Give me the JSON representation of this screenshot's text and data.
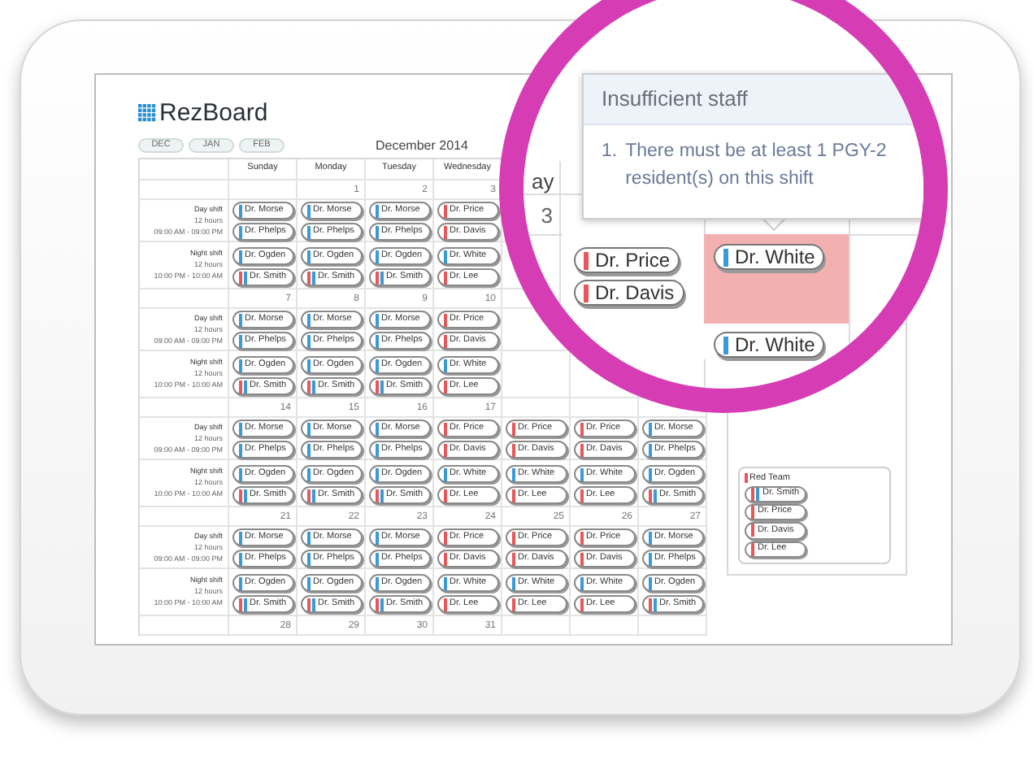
{
  "app": {
    "logo": "RezBoard"
  },
  "months": [
    "DEC",
    "JAN",
    "FEB"
  ],
  "calendar_title": "December 2014",
  "weekdays": [
    "Sunday",
    "Monday",
    "Tuesday",
    "Wednesday"
  ],
  "weeks": [
    {
      "shift_labels": [
        {
          "name": "Day shift",
          "hours": "12 hours",
          "time": "09:00 AM - 09:00 PM"
        },
        {
          "name": "Night shift",
          "hours": "12 hours",
          "time": "10:00 PM - 10:00 AM"
        }
      ],
      "days": [
        {
          "day_shift": [
            {
              "name": "Dr. Morse",
              "bars": [
                {
                  "color": "#3a9ad9"
                }
              ]
            },
            {
              "name": "Dr. Phelps",
              "bars": [
                {
                  "color": "#3a9ad9"
                }
              ]
            }
          ],
          "night_shift": [
            {
              "name": "Dr. Ogden",
              "bars": [
                {
                  "color": "#3a9ad9"
                }
              ]
            },
            {
              "name": "Dr. Smith",
              "bars": [
                {
                  "color": "#e8585a"
                },
                {
                  "color": "#3a9ad9"
                }
              ]
            }
          ]
        },
        {
          "date": "1",
          "day_shift": [
            {
              "name": "Dr. Morse",
              "bars": [
                {
                  "color": "#3a9ad9"
                }
              ]
            },
            {
              "name": "Dr. Phelps",
              "bars": [
                {
                  "color": "#3a9ad9"
                }
              ]
            }
          ],
          "night_shift": [
            {
              "name": "Dr. Ogden",
              "bars": [
                {
                  "color": "#3a9ad9"
                }
              ]
            },
            {
              "name": "Dr. Smith",
              "bars": [
                {
                  "color": "#e8585a"
                },
                {
                  "color": "#3a9ad9"
                }
              ]
            }
          ]
        },
        {
          "date": "2",
          "day_shift": [
            {
              "name": "Dr. Morse",
              "bars": [
                {
                  "color": "#3a9ad9"
                }
              ]
            },
            {
              "name": "Dr. Phelps",
              "bars": [
                {
                  "color": "#3a9ad9"
                }
              ]
            }
          ],
          "night_shift": [
            {
              "name": "Dr. Ogden",
              "bars": [
                {
                  "color": "#3a9ad9"
                }
              ]
            },
            {
              "name": "Dr. Smith",
              "bars": [
                {
                  "color": "#e8585a"
                },
                {
                  "color": "#3a9ad9"
                }
              ]
            }
          ]
        },
        {
          "date": "3",
          "day_shift": [
            {
              "name": "Dr. Price",
              "bars": [
                {
                  "color": "#e8585a"
                }
              ]
            },
            {
              "name": "Dr. Davis",
              "bars": [
                {
                  "color": "#e8585a"
                }
              ]
            }
          ],
          "night_shift": [
            {
              "name": "Dr. White",
              "bars": [
                {
                  "color": "#3a9ad9"
                }
              ]
            },
            {
              "name": "Dr. Lee",
              "bars": [
                {
                  "color": "#e8585a"
                }
              ]
            }
          ]
        }
      ]
    },
    {
      "shift_labels": [
        {
          "name": "Day shift",
          "hours": "12 hours",
          "time": "09:00 AM - 09:00 PM"
        },
        {
          "name": "Night shift",
          "hours": "12 hours",
          "time": "10:00 PM - 10:00 AM"
        }
      ],
      "days": [
        {
          "date": "7",
          "day_shift": [
            {
              "name": "Dr. Morse",
              "bars": [
                {
                  "color": "#3a9ad9"
                }
              ]
            },
            {
              "name": "Dr. Phelps",
              "bars": [
                {
                  "color": "#3a9ad9"
                }
              ]
            }
          ],
          "night_shift": [
            {
              "name": "Dr. Ogden",
              "bars": [
                {
                  "color": "#3a9ad9"
                }
              ]
            },
            {
              "name": "Dr. Smith",
              "bars": [
                {
                  "color": "#e8585a"
                },
                {
                  "color": "#3a9ad9"
                }
              ]
            }
          ]
        },
        {
          "date": "8",
          "day_shift": [
            {
              "name": "Dr. Morse",
              "bars": [
                {
                  "color": "#3a9ad9"
                }
              ]
            },
            {
              "name": "Dr. Phelps",
              "bars": [
                {
                  "color": "#3a9ad9"
                }
              ]
            }
          ],
          "night_shift": [
            {
              "name": "Dr. Ogden",
              "bars": [
                {
                  "color": "#3a9ad9"
                }
              ]
            },
            {
              "name": "Dr. Smith",
              "bars": [
                {
                  "color": "#e8585a"
                },
                {
                  "color": "#3a9ad9"
                }
              ]
            }
          ]
        },
        {
          "date": "9",
          "day_shift": [
            {
              "name": "Dr. Morse",
              "bars": [
                {
                  "color": "#3a9ad9"
                }
              ]
            },
            {
              "name": "Dr. Phelps",
              "bars": [
                {
                  "color": "#3a9ad9"
                }
              ]
            }
          ],
          "night_shift": [
            {
              "name": "Dr. Ogden",
              "bars": [
                {
                  "color": "#3a9ad9"
                }
              ]
            },
            {
              "name": "Dr. Smith",
              "bars": [
                {
                  "color": "#e8585a"
                },
                {
                  "color": "#3a9ad9"
                }
              ]
            }
          ]
        },
        {
          "date": "10",
          "day_shift": [
            {
              "name": "Dr. Price",
              "bars": [
                {
                  "color": "#e8585a"
                }
              ]
            },
            {
              "name": "Dr. Davis",
              "bars": [
                {
                  "color": "#e8585a"
                }
              ]
            }
          ],
          "night_shift": [
            {
              "name": "Dr. White",
              "bars": [
                {
                  "color": "#3a9ad9"
                }
              ]
            },
            {
              "name": "Dr. Lee",
              "bars": [
                {
                  "color": "#e8585a"
                }
              ]
            }
          ]
        }
      ]
    },
    {
      "shift_labels": [
        {
          "name": "Day shift",
          "hours": "12 hours",
          "time": "09:00 AM - 09:00 PM"
        },
        {
          "name": "Night shift",
          "hours": "12 hours",
          "time": "10:00 PM - 10:00 AM"
        }
      ],
      "days": [
        {
          "date": "14",
          "day_shift": [
            {
              "name": "Dr. Morse",
              "bars": [
                {
                  "color": "#3a9ad9"
                }
              ]
            },
            {
              "name": "Dr. Phelps",
              "bars": [
                {
                  "color": "#3a9ad9"
                }
              ]
            }
          ],
          "night_shift": [
            {
              "name": "Dr. Ogden",
              "bars": [
                {
                  "color": "#3a9ad9"
                }
              ]
            },
            {
              "name": "Dr. Smith",
              "bars": [
                {
                  "color": "#e8585a"
                },
                {
                  "color": "#3a9ad9"
                }
              ]
            }
          ]
        },
        {
          "date": "15",
          "day_shift": [
            {
              "name": "Dr. Morse",
              "bars": [
                {
                  "color": "#3a9ad9"
                }
              ]
            },
            {
              "name": "Dr. Phelps",
              "bars": [
                {
                  "color": "#3a9ad9"
                }
              ]
            }
          ],
          "night_shift": [
            {
              "name": "Dr. Ogden",
              "bars": [
                {
                  "color": "#3a9ad9"
                }
              ]
            },
            {
              "name": "Dr. Smith",
              "bars": [
                {
                  "color": "#e8585a"
                },
                {
                  "color": "#3a9ad9"
                }
              ]
            }
          ]
        },
        {
          "date": "16",
          "day_shift": [
            {
              "name": "Dr. Morse",
              "bars": [
                {
                  "color": "#3a9ad9"
                }
              ]
            },
            {
              "name": "Dr. Phelps",
              "bars": [
                {
                  "color": "#3a9ad9"
                }
              ]
            }
          ],
          "night_shift": [
            {
              "name": "Dr. Ogden",
              "bars": [
                {
                  "color": "#3a9ad9"
                }
              ]
            },
            {
              "name": "Dr. Smith",
              "bars": [
                {
                  "color": "#e8585a"
                },
                {
                  "color": "#3a9ad9"
                }
              ]
            }
          ]
        },
        {
          "date": "17",
          "day_shift": [
            {
              "name": "Dr. Price",
              "bars": [
                {
                  "color": "#e8585a"
                }
              ]
            },
            {
              "name": "Dr. Davis",
              "bars": [
                {
                  "color": "#e8585a"
                }
              ]
            }
          ],
          "night_shift": [
            {
              "name": "Dr. White",
              "bars": [
                {
                  "color": "#3a9ad9"
                }
              ]
            },
            {
              "name": "Dr. Lee",
              "bars": [
                {
                  "color": "#e8585a"
                }
              ]
            }
          ]
        },
        {
          "day_shift": [
            {
              "name": "Dr. Price",
              "bars": [
                {
                  "color": "#e8585a"
                }
              ]
            },
            {
              "name": "Dr. Davis",
              "bars": [
                {
                  "color": "#e8585a"
                }
              ]
            }
          ],
          "night_shift": [
            {
              "name": "Dr. White",
              "bars": [
                {
                  "color": "#3a9ad9"
                }
              ]
            },
            {
              "name": "Dr. Lee",
              "bars": [
                {
                  "color": "#e8585a"
                }
              ]
            }
          ]
        },
        {
          "day_shift": [
            {
              "name": "Dr. Price",
              "bars": [
                {
                  "color": "#e8585a"
                }
              ]
            },
            {
              "name": "Dr. Davis",
              "bars": [
                {
                  "color": "#e8585a"
                }
              ]
            }
          ],
          "night_shift": [
            {
              "name": "Dr. White",
              "bars": [
                {
                  "color": "#3a9ad9"
                }
              ]
            },
            {
              "name": "Dr. Lee",
              "bars": [
                {
                  "color": "#e8585a"
                }
              ]
            }
          ]
        },
        {
          "day_shift": [
            {
              "name": "Dr. Morse",
              "bars": [
                {
                  "color": "#3a9ad9"
                }
              ]
            },
            {
              "name": "Dr. Phelps",
              "bars": [
                {
                  "color": "#3a9ad9"
                }
              ]
            }
          ],
          "night_shift": [
            {
              "name": "Dr. Ogden",
              "bars": [
                {
                  "color": "#3a9ad9"
                }
              ]
            },
            {
              "name": "Dr. Smith",
              "bars": [
                {
                  "color": "#e8585a"
                },
                {
                  "color": "#3a9ad9"
                }
              ]
            }
          ]
        }
      ]
    },
    {
      "shift_labels": [
        {
          "name": "Day shift",
          "hours": "12 hours",
          "time": "09:00 AM - 09:00 PM"
        },
        {
          "name": "Night shift",
          "hours": "12 hours",
          "time": "10:00 PM - 10:00 AM"
        }
      ],
      "days": [
        {
          "date": "21",
          "day_shift": [
            {
              "name": "Dr. Morse",
              "bars": [
                {
                  "color": "#3a9ad9"
                }
              ]
            },
            {
              "name": "Dr. Phelps",
              "bars": [
                {
                  "color": "#3a9ad9"
                }
              ]
            }
          ],
          "night_shift": [
            {
              "name": "Dr. Ogden",
              "bars": [
                {
                  "color": "#3a9ad9"
                }
              ]
            },
            {
              "name": "Dr. Smith",
              "bars": [
                {
                  "color": "#e8585a"
                },
                {
                  "color": "#3a9ad9"
                }
              ]
            }
          ]
        },
        {
          "date": "22",
          "day_shift": [
            {
              "name": "Dr. Morse",
              "bars": [
                {
                  "color": "#3a9ad9"
                }
              ]
            },
            {
              "name": "Dr. Phelps",
              "bars": [
                {
                  "color": "#3a9ad9"
                }
              ]
            }
          ],
          "night_shift": [
            {
              "name": "Dr. Ogden",
              "bars": [
                {
                  "color": "#3a9ad9"
                }
              ]
            },
            {
              "name": "Dr. Smith",
              "bars": [
                {
                  "color": "#e8585a"
                },
                {
                  "color": "#3a9ad9"
                }
              ]
            }
          ]
        },
        {
          "date": "23",
          "day_shift": [
            {
              "name": "Dr. Morse",
              "bars": [
                {
                  "color": "#3a9ad9"
                }
              ]
            },
            {
              "name": "Dr. Phelps",
              "bars": [
                {
                  "color": "#3a9ad9"
                }
              ]
            }
          ],
          "night_shift": [
            {
              "name": "Dr. Ogden",
              "bars": [
                {
                  "color": "#3a9ad9"
                }
              ]
            },
            {
              "name": "Dr. Smith",
              "bars": [
                {
                  "color": "#e8585a"
                },
                {
                  "color": "#3a9ad9"
                }
              ]
            }
          ]
        },
        {
          "date": "24",
          "day_shift": [
            {
              "name": "Dr. Price",
              "bars": [
                {
                  "color": "#e8585a"
                }
              ]
            },
            {
              "name": "Dr. Davis",
              "bars": [
                {
                  "color": "#e8585a"
                }
              ]
            }
          ],
          "night_shift": [
            {
              "name": "Dr. White",
              "bars": [
                {
                  "color": "#3a9ad9"
                }
              ]
            },
            {
              "name": "Dr. Lee",
              "bars": [
                {
                  "color": "#e8585a"
                }
              ]
            }
          ]
        },
        {
          "date": "25",
          "day_shift": [
            {
              "name": "Dr. Price",
              "bars": [
                {
                  "color": "#e8585a"
                }
              ]
            },
            {
              "name": "Dr. Davis",
              "bars": [
                {
                  "color": "#e8585a"
                }
              ]
            }
          ],
          "night_shift": [
            {
              "name": "Dr. White",
              "bars": [
                {
                  "color": "#3a9ad9"
                }
              ]
            },
            {
              "name": "Dr. Lee",
              "bars": [
                {
                  "color": "#e8585a"
                }
              ]
            }
          ]
        },
        {
          "date": "26",
          "day_shift": [
            {
              "name": "Dr. Price",
              "bars": [
                {
                  "color": "#e8585a"
                }
              ]
            },
            {
              "name": "Dr. Davis",
              "bars": [
                {
                  "color": "#e8585a"
                }
              ]
            }
          ],
          "night_shift": [
            {
              "name": "Dr. White",
              "bars": [
                {
                  "color": "#3a9ad9"
                }
              ]
            },
            {
              "name": "Dr. Lee",
              "bars": [
                {
                  "color": "#e8585a"
                }
              ]
            }
          ]
        },
        {
          "date": "27",
          "day_shift": [
            {
              "name": "Dr. Morse",
              "bars": [
                {
                  "color": "#3a9ad9"
                }
              ]
            },
            {
              "name": "Dr. Phelps",
              "bars": [
                {
                  "color": "#3a9ad9"
                }
              ]
            }
          ],
          "night_shift": [
            {
              "name": "Dr. Ogden",
              "bars": [
                {
                  "color": "#3a9ad9"
                }
              ]
            },
            {
              "name": "Dr. Smith",
              "bars": [
                {
                  "color": "#e8585a"
                },
                {
                  "color": "#3a9ad9"
                }
              ]
            }
          ]
        }
      ]
    },
    {
      "days": [
        {
          "date": "28"
        },
        {
          "date": "29"
        },
        {
          "date": "30"
        },
        {
          "date": "31"
        }
      ]
    }
  ],
  "teams": [
    {
      "name": "Red Team",
      "color": "#e8585a",
      "members": [
        {
          "name": "Dr. Smith",
          "bars": [
            {
              "color": "#e8585a"
            },
            {
              "color": "#3a9ad9"
            }
          ]
        },
        {
          "name": "Dr. Price",
          "bars": [
            {
              "color": "#e8585a"
            }
          ]
        },
        {
          "name": "Dr. Davis",
          "bars": [
            {
              "color": "#e8585a"
            }
          ]
        },
        {
          "name": "Dr. Lee",
          "bars": [
            {
              "color": "#e8585a"
            }
          ]
        }
      ]
    }
  ],
  "magnifier": {
    "popover": {
      "title": "Insufficient staff",
      "items": [
        {
          "number": "1.",
          "text": "There must be at least 1 PGY-2 resident(s) on this shift"
        }
      ]
    },
    "header_fragment": "ay",
    "date": "3",
    "cells": [
      {
        "error": false,
        "chips": [
          {
            "name": "Dr. Price",
            "bars": [
              {
                "color": "#e8585a"
              }
            ]
          },
          {
            "name": "Dr. Davis",
            "bars": [
              {
                "color": "#e8585a"
              }
            ]
          }
        ]
      },
      {
        "error": true,
        "chips": [
          {
            "name": "Dr. White",
            "bars": [
              {
                "color": "#3a9ad9"
              }
            ]
          }
        ]
      },
      {
        "error": false,
        "chips": [
          {
            "name": "Dr. White",
            "bars": [
              {
                "color": "#3a9ad9"
              }
            ]
          }
        ]
      }
    ]
  }
}
